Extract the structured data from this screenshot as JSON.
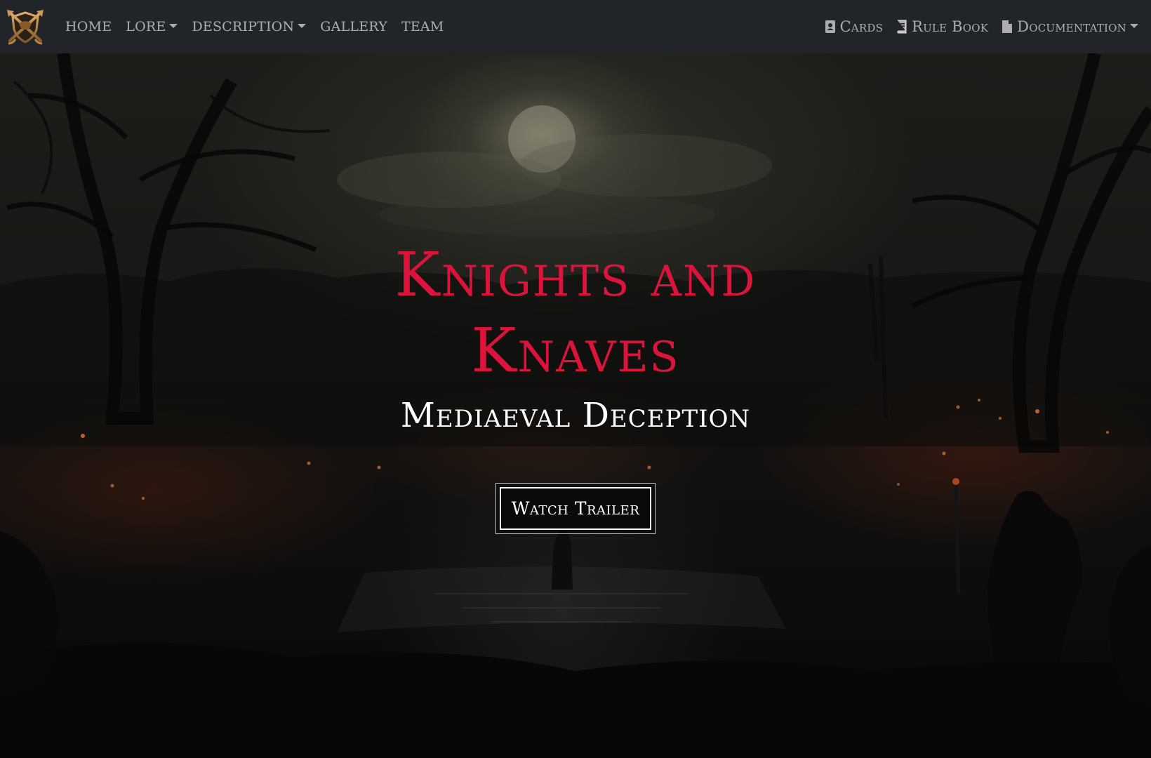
{
  "nav": {
    "brand_logo": "crossed-swords-shield-logo",
    "left_items": [
      {
        "label": "HOME",
        "dropdown": false
      },
      {
        "label": "LORE",
        "dropdown": true
      },
      {
        "label": "DESCRIPTION",
        "dropdown": true
      },
      {
        "label": "GALLERY",
        "dropdown": false
      },
      {
        "label": "TEAM",
        "dropdown": false
      }
    ],
    "right_items": [
      {
        "label": "Cards",
        "icon": "contact-card-icon",
        "dropdown": false
      },
      {
        "label": "Rule Book",
        "icon": "book-icon",
        "dropdown": false
      },
      {
        "label": "Documentation",
        "icon": "file-icon",
        "dropdown": true
      }
    ]
  },
  "hero": {
    "title": "Knights and Knaves",
    "subtitle": "Mediaeval Deception",
    "button_label": "Watch Trailer",
    "background": "dark-swamp-forest-moon-illustration"
  },
  "colors": {
    "navbar_bg": "#212529",
    "title": "#dc143c",
    "text": "#ffffff",
    "nav_text": "rgba(255,255,255,0.62)"
  }
}
